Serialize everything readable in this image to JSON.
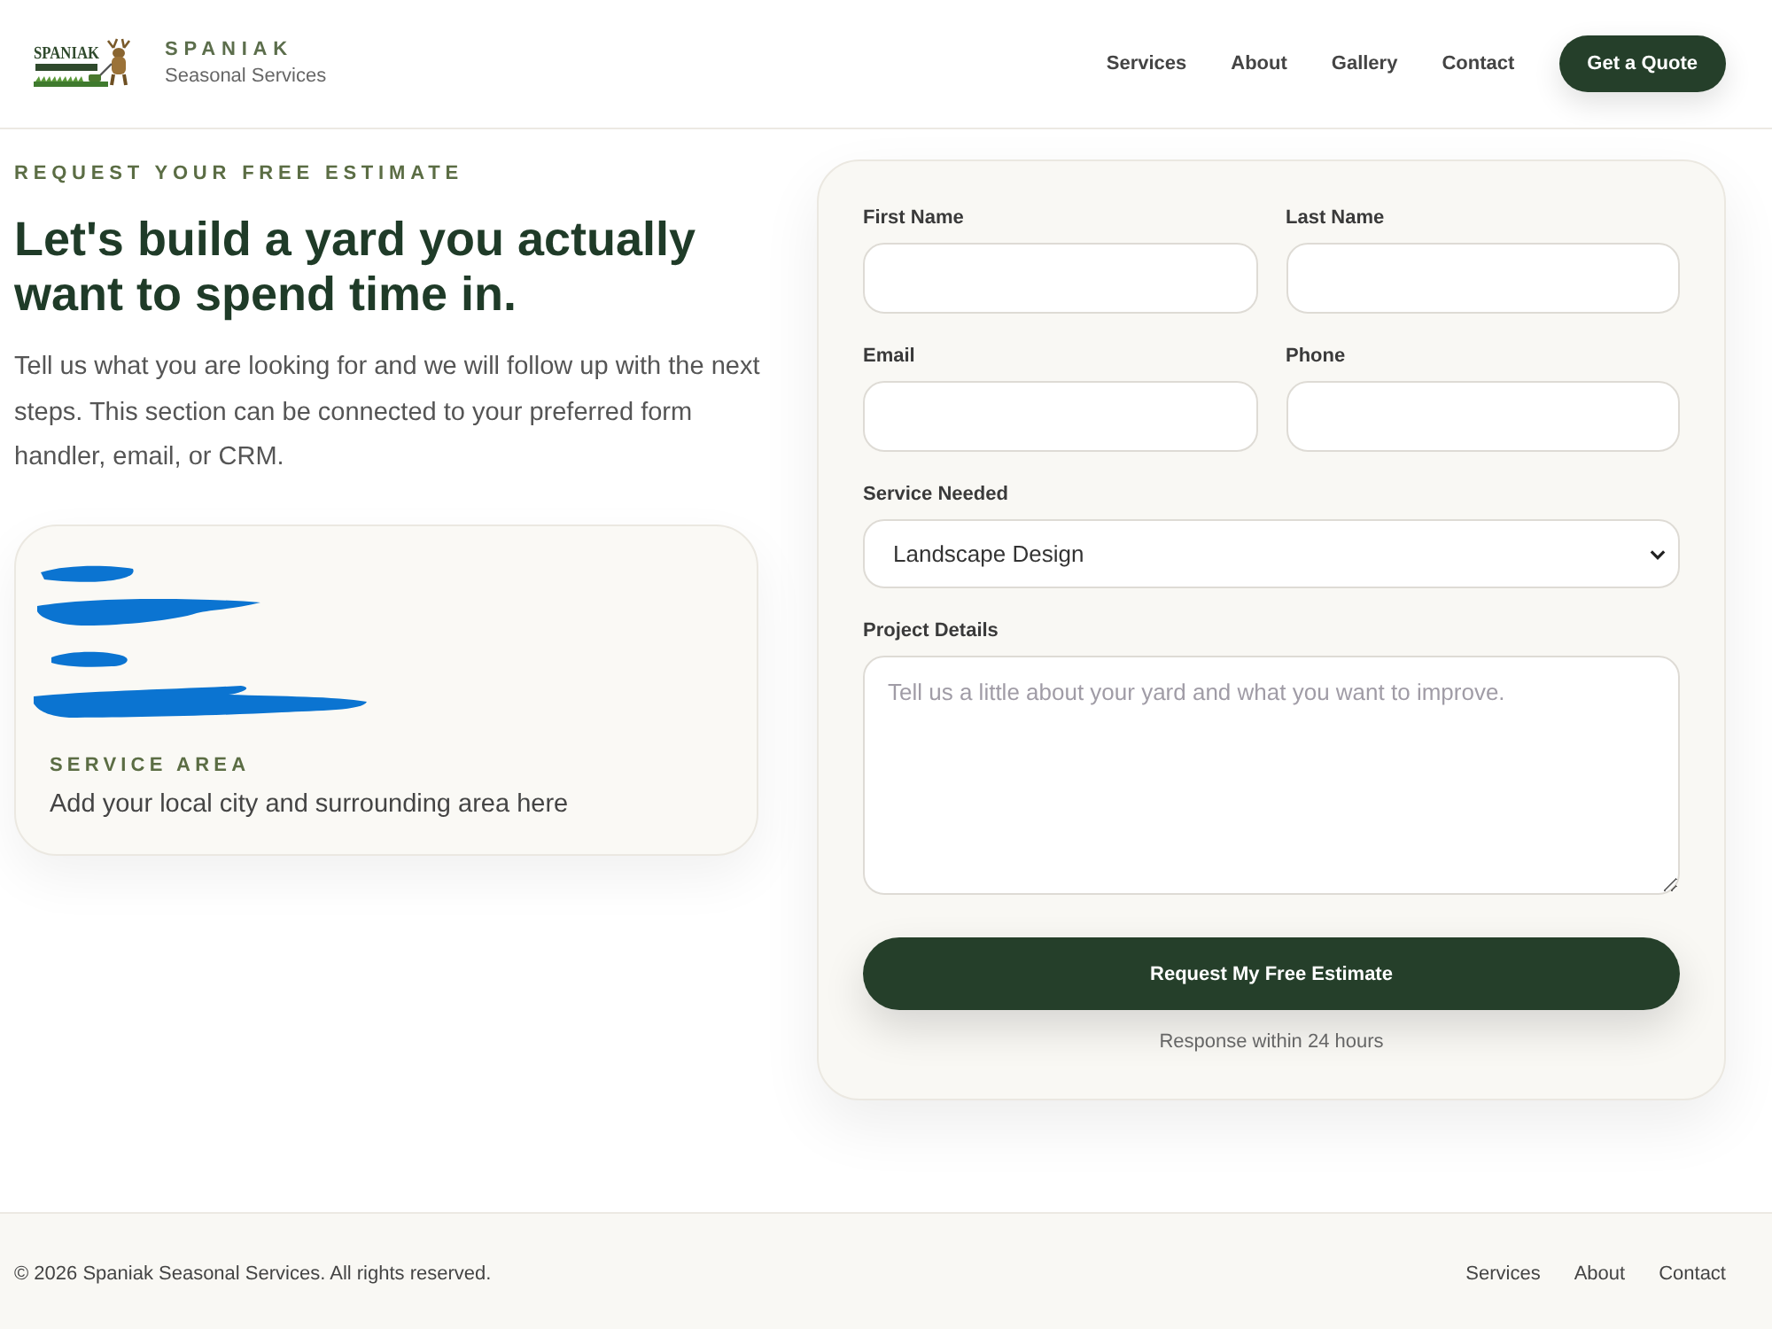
{
  "header": {
    "logo": {
      "wordmark": "SPANIAK"
    },
    "brand": {
      "name": "SPANIAK",
      "tagline": "Seasonal Services"
    },
    "nav": [
      {
        "label": "Services"
      },
      {
        "label": "About"
      },
      {
        "label": "Gallery"
      },
      {
        "label": "Contact"
      }
    ],
    "cta": "Get a Quote"
  },
  "intro": {
    "eyebrow": "REQUEST YOUR FREE ESTIMATE",
    "heading": "Let's build a yard you actually want to spend time in.",
    "body": "Tell us what you are looking for and we will follow up with the next steps. This section can be connected to your preferred form handler, email, or CRM."
  },
  "service_area_card": {
    "label": "SERVICE AREA",
    "text": "Add your local city and surrounding area here"
  },
  "form": {
    "fields": [
      {
        "kind": "input",
        "label": "First Name"
      },
      {
        "kind": "input",
        "label": "Last Name"
      },
      {
        "kind": "input",
        "label": "Email"
      },
      {
        "kind": "input",
        "label": "Phone"
      },
      {
        "kind": "select",
        "label": "Service Needed",
        "value": "Landscape Design"
      },
      {
        "kind": "textarea",
        "label": "Project Details",
        "placeholder": "Tell us a little about your yard and what you want to improve."
      }
    ],
    "submit": "Request My Free Estimate",
    "note": "Response within 24 hours"
  },
  "footer": {
    "copyright": "© 2026 Spaniak Seasonal Services. All rights reserved.",
    "links": [
      {
        "label": "Services"
      },
      {
        "label": "About"
      },
      {
        "label": "Contact"
      }
    ]
  }
}
